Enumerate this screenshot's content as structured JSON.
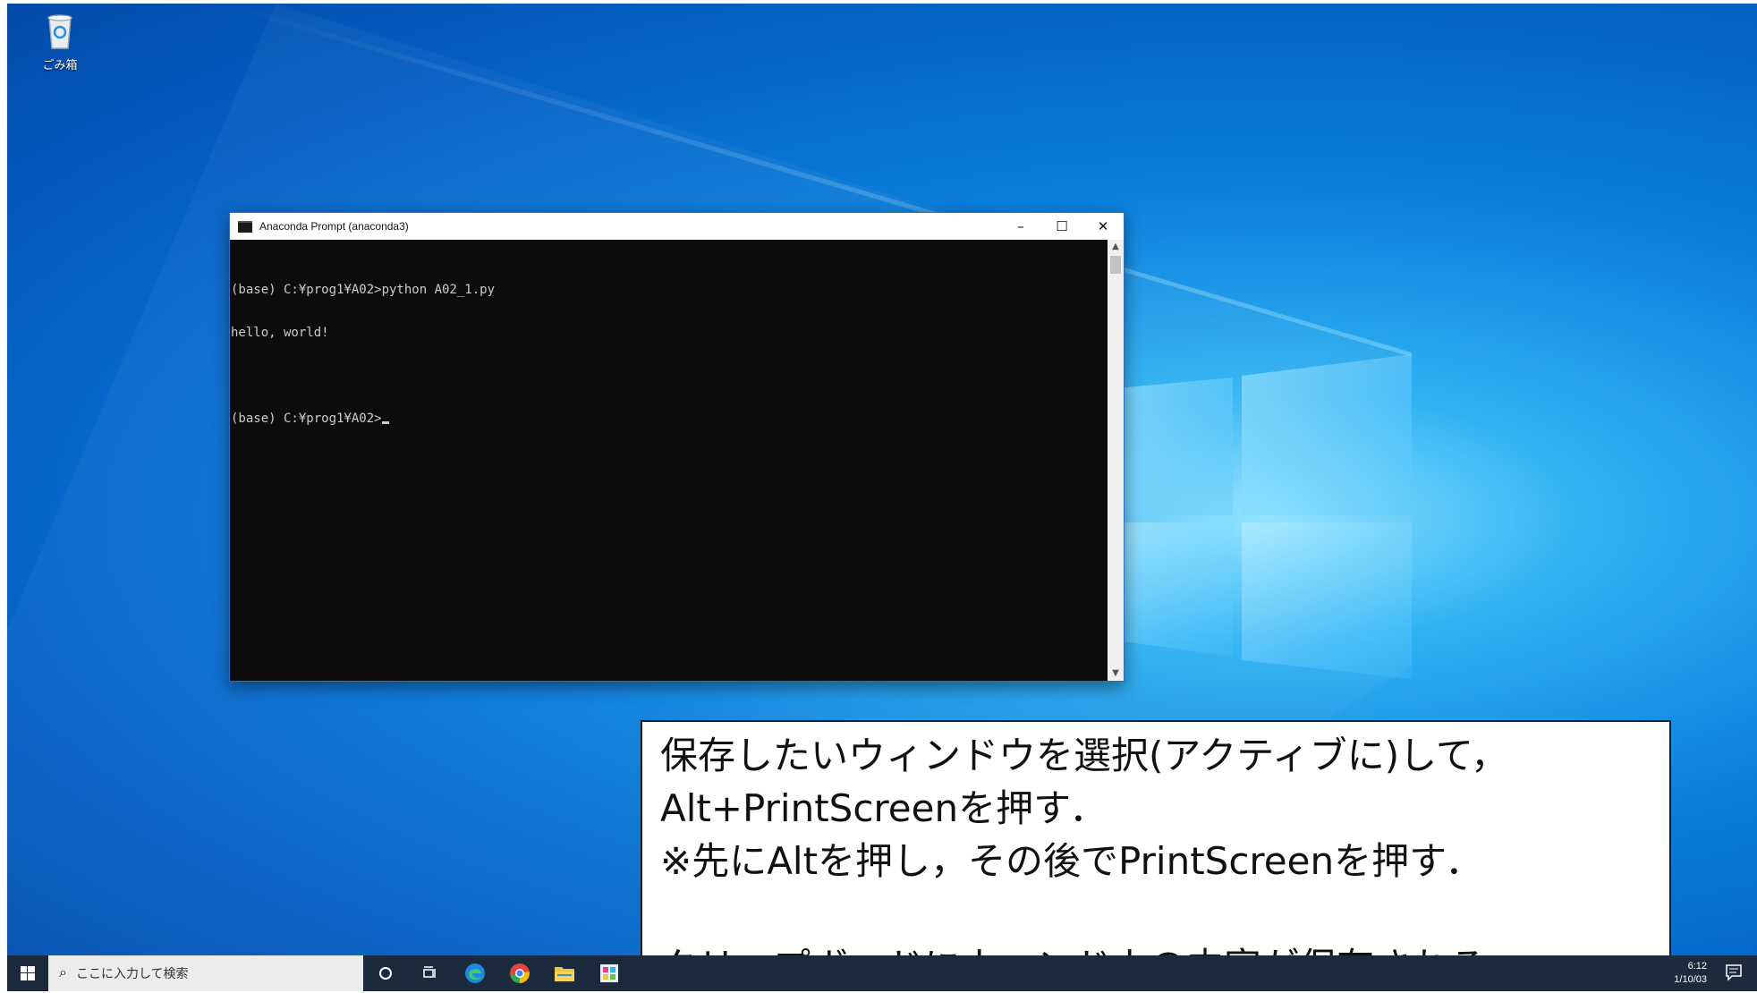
{
  "desktop": {
    "recycle_bin_label": "ごみ箱"
  },
  "window": {
    "title": "Anaconda Prompt (anaconda3)",
    "minimize": "–",
    "maximize": "☐",
    "close": "✕",
    "console_lines": [
      "(base) C:¥prog1¥A02>python A02_1.py",
      "hello, world!",
      "",
      "(base) C:¥prog1¥A02>"
    ]
  },
  "note": {
    "lines": [
      "保存したいウィンドウを選択(アクティブに)して，",
      "Alt+PrintScreenを押す．",
      "※先にAltを押し，その後でPrintScreenを押す．",
      "",
      "クリップボードにウィンドウの内容が保存される．"
    ]
  },
  "taskbar": {
    "search_placeholder": "ここに入力して検索",
    "icons": [
      "cortana-icon",
      "task-view-icon",
      "edge-icon",
      "chrome-icon",
      "file-explorer-icon",
      "paint-icon"
    ],
    "clock_time": "6:12",
    "clock_date": "1/10/03"
  },
  "colors": {
    "desktop_blue": "#0b7fdc",
    "taskbar": "#1b2a3d",
    "console_bg": "#0c0c0c",
    "console_fg": "#cccccc"
  }
}
